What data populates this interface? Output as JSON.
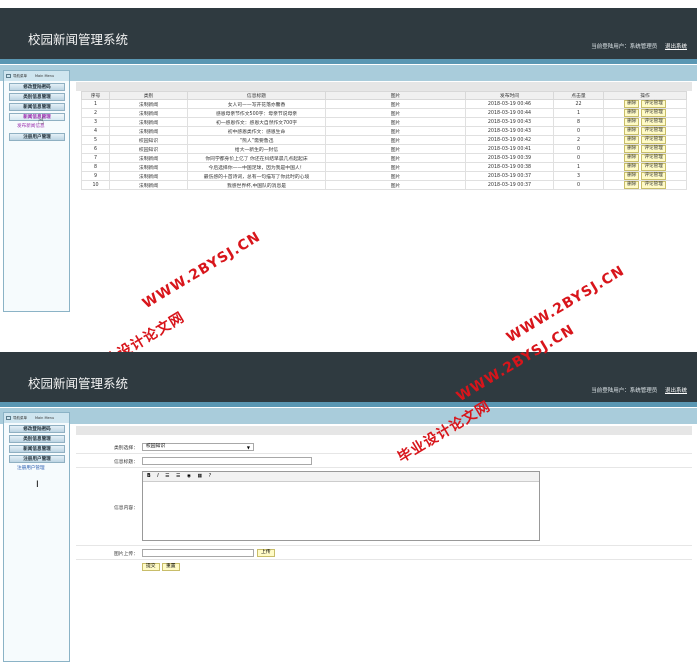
{
  "app_title": "校园新闻管理系统",
  "user_label": "当前登陆用户：",
  "user_name": "系统管理员",
  "logout_label": "退出系统",
  "sidebar": {
    "title_cn": "导航菜单",
    "title_en": "Main Menu",
    "items": [
      {
        "label": "修改登陆密码"
      },
      {
        "label": "类别信息管理"
      },
      {
        "label": "新闻信息管理"
      },
      {
        "label": "新闻信息管理"
      },
      {
        "label": "注册用户管理"
      }
    ],
    "shot1_items": [
      "修改登陆密码",
      "类别信息管理",
      "新闻信息管理",
      "新闻信息管理",
      "注册用户管理"
    ],
    "shot1_submenu": "发布新闻信息",
    "shot2_items": [
      "修改登陆密码",
      "类别信息管理",
      "新闻信息管理",
      "注册用户管理"
    ],
    "shot2_submenu": "注册用户管理"
  },
  "table": {
    "headers": [
      "序号",
      "类别",
      "信息标题",
      "图片",
      "发布时间",
      "点击量",
      "操作"
    ],
    "rows": [
      [
        "1",
        "法制新闻",
        "女人司——写开花落亦馨香",
        "图片",
        "2018-03-19 00:46",
        "22"
      ],
      [
        "2",
        "法制新闻",
        "感恩母亲节作文500字：母亲节说母亲",
        "图片",
        "2018-03-19 00:44",
        "1"
      ],
      [
        "3",
        "法制新闻",
        "初一感恩作文：感恩大自然作文700字",
        "图片",
        "2018-03-19 00:43",
        "8"
      ],
      [
        "4",
        "法制新闻",
        "初中感恩类作文：感恩生命",
        "图片",
        "2018-03-19 00:43",
        "0"
      ],
      [
        "5",
        "校园知识",
        "“熊人”需要鲁迅",
        "图片",
        "2018-03-19 00:42",
        "2"
      ],
      [
        "6",
        "校园知识",
        "给大一新生的一封信",
        "图片",
        "2018-03-19 00:41",
        "0"
      ],
      [
        "7",
        "法制新闻",
        "你同学都身价上亿了 你还在纠结早晨几点起起床",
        "图片",
        "2018-03-19 00:39",
        "0"
      ],
      [
        "8",
        "法制新闻",
        "今后选择你——中国足球，因为我是中国人！",
        "图片",
        "2018-03-19 00:38",
        "1"
      ],
      [
        "9",
        "法制新闻",
        "最伤感的十首诗词，总有一句描写了你此时的心境",
        "图片",
        "2018-03-19 00:37",
        "3"
      ],
      [
        "10",
        "法制新闻",
        "我感世界杯,中国队的消息是",
        "图片",
        "2018-03-19 00:37",
        "0"
      ]
    ],
    "btn_delete": "删除",
    "btn_comment": "评论管理"
  },
  "form": {
    "category_label": "类别选择：",
    "category_value": "校园知识",
    "title_label": "信息标题：",
    "content_label": "信息内容：",
    "editor_tools": [
      "B",
      "I",
      "☰",
      "☰",
      "◉",
      "▦",
      "?"
    ],
    "upload_label": "图片上传：",
    "upload_btn": "上传",
    "submit_btn": "提交",
    "reset_btn": "重置"
  },
  "watermark": {
    "cn": "毕业设计论文网",
    "url": "WWW.2BYSJ.CN"
  },
  "colors": {
    "header_bg": "#2f3a40",
    "accent_band": "#a9ccdb",
    "active_menu_text": "#9b2fae",
    "watermark": "#d8151b",
    "button_bg": "#fffbc7"
  }
}
